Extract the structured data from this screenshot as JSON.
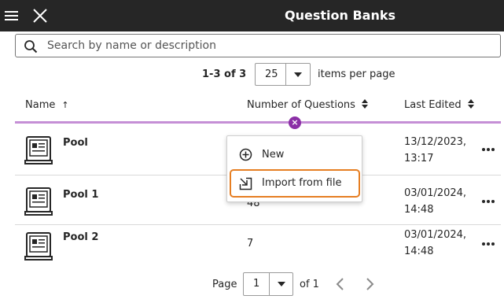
{
  "topbar": {
    "title": "Question Banks",
    "menu_icon": "hamburger-icon",
    "close_icon": "close-icon"
  },
  "search": {
    "placeholder": "Search by name or description",
    "value": "",
    "icon": "search-icon"
  },
  "pagination_top": {
    "count_label": "1-3 of 3",
    "per_page_value": "25",
    "per_page_label": "items per page"
  },
  "table": {
    "columns": [
      {
        "label": "Name",
        "sort": "ascending"
      },
      {
        "label": "Number of Questions",
        "sort": "none"
      },
      {
        "label": "Last Edited",
        "sort": "none"
      }
    ],
    "rows": [
      {
        "name": "Pool",
        "questions": "",
        "date": "13/12/2023,",
        "time": "13:17"
      },
      {
        "name": "Pool 1",
        "questions": "48",
        "date": "03/01/2024,",
        "time": "14:48"
      },
      {
        "name": "Pool 2",
        "questions": "7",
        "date": "03/01/2024,",
        "time": "14:48"
      }
    ]
  },
  "insert_button": {
    "icon": "close-circle-icon",
    "label": "×"
  },
  "add_menu": {
    "items": [
      {
        "label": "New",
        "icon": "plus-circle-icon"
      },
      {
        "label": "Import from file",
        "icon": "import-icon",
        "focused": true
      }
    ]
  },
  "pagination_bottom": {
    "page_label": "Page",
    "page_value": "1",
    "of_label": "of 1"
  },
  "colors": {
    "topbar_bg": "#262626",
    "accent_purple": "#8b2fa6",
    "insert_line": "#c58fd6",
    "focus_ring": "#e67e22"
  }
}
